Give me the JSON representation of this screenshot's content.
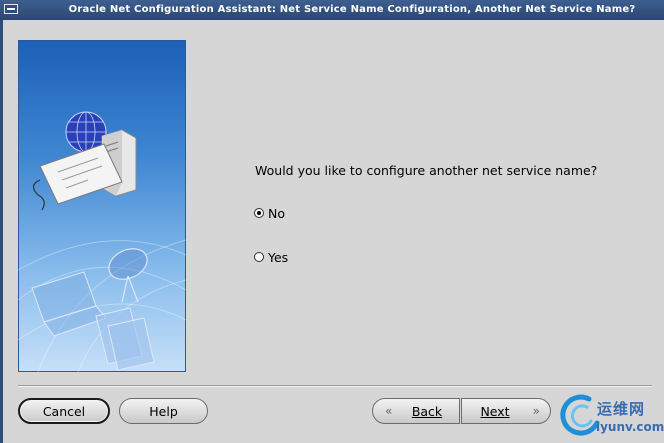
{
  "window": {
    "title": "Oracle Net Configuration Assistant: Net Service Name Configuration, Another Net Service Name?"
  },
  "main": {
    "question": "Would you like to configure another net service name?",
    "options": [
      {
        "label": "No",
        "selected": true
      },
      {
        "label": "Yes",
        "selected": false
      }
    ]
  },
  "buttons": {
    "cancel": "Cancel",
    "help": "Help",
    "back": "Back",
    "next": "Next"
  },
  "watermark": {
    "brand": "运维网",
    "url": "iyunv.com"
  },
  "icons": {
    "back": "chevron-left-double-icon",
    "next": "chevron-right-double-icon"
  },
  "colors": {
    "titlebar": "#2f4d7c",
    "background": "#d6d6d6",
    "side_image_top": "#1c60b8",
    "watermark": "#3a6bb0"
  }
}
